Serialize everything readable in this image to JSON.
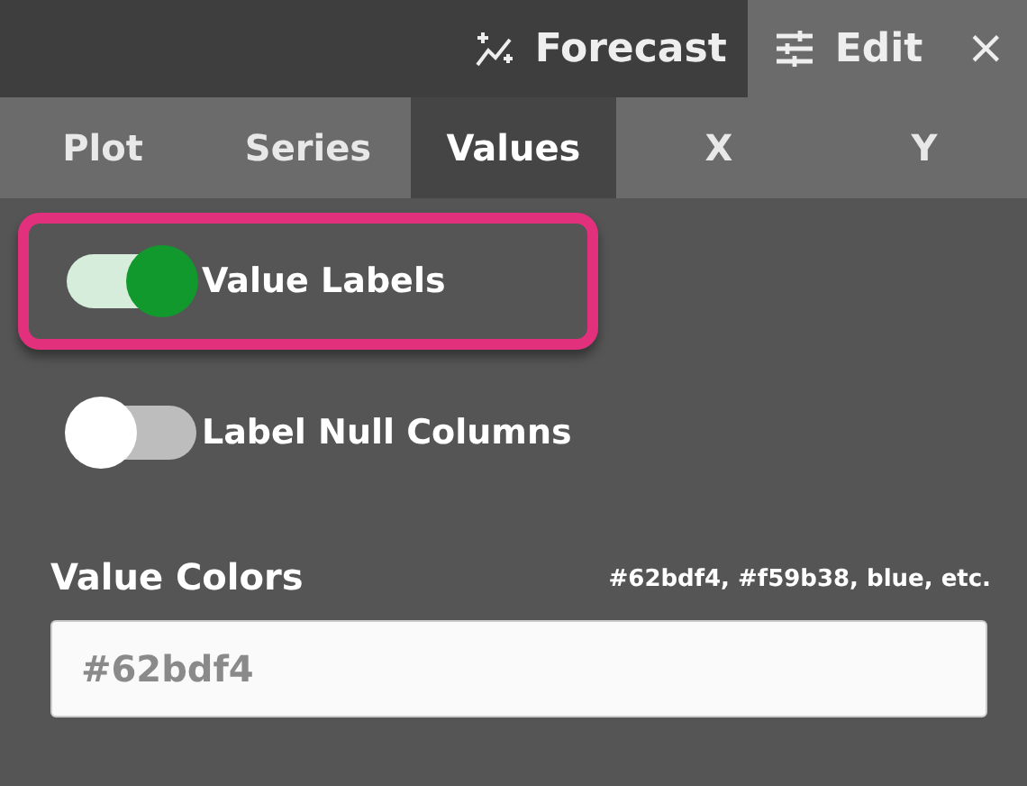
{
  "top_tabs": [
    {
      "label": "Forecast",
      "kind": "sparkline",
      "selected": false
    },
    {
      "label": "Edit",
      "kind": "sliders",
      "selected": true
    }
  ],
  "close": "×",
  "sub_tabs": [
    {
      "label": "Plot",
      "selected": false
    },
    {
      "label": "Series",
      "selected": false
    },
    {
      "label": "Values",
      "selected": true
    },
    {
      "label": "X",
      "selected": false
    },
    {
      "label": "Y",
      "selected": false
    }
  ],
  "toggles": [
    {
      "label": "Value Labels",
      "on": true,
      "highlighted": true
    },
    {
      "label": "Label Null Columns",
      "on": false,
      "highlighted": false
    }
  ],
  "value_colors": {
    "label": "Value Colors",
    "hint": "#62bdf4, #f59b38, blue, etc.",
    "placeholder": "#62bdf4"
  }
}
